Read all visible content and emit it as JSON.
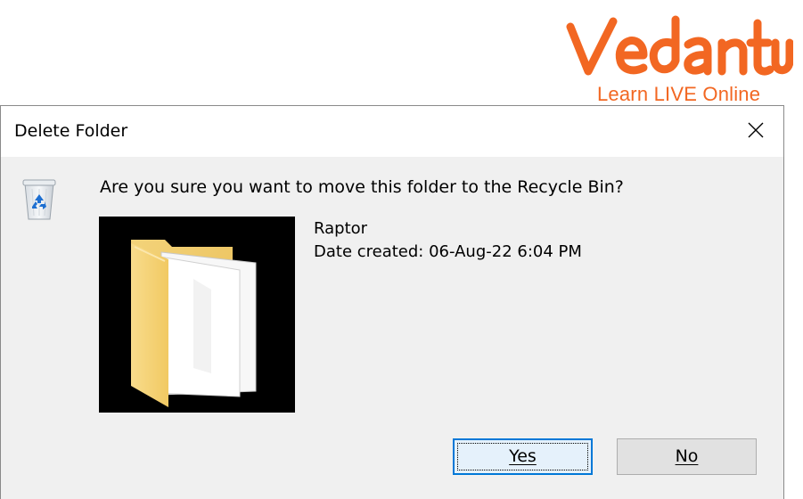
{
  "logo": {
    "wordmark": "Vedantu",
    "tagline": "Learn LIVE Online",
    "color": "#f26722"
  },
  "dialog": {
    "title": "Delete Folder",
    "close_icon": "close-icon",
    "recycle_bin_icon": "recycle-bin-icon",
    "question": "Are you sure you want to move this folder to the Recycle Bin?",
    "item": {
      "name": "Raptor",
      "date_created": "Date created: 06-Aug-22 6:04 PM",
      "thumbnail_icon": "folder-icon"
    },
    "buttons": {
      "yes_label": "Yes",
      "no_label": "No"
    },
    "accent_color": "#0078d7"
  }
}
